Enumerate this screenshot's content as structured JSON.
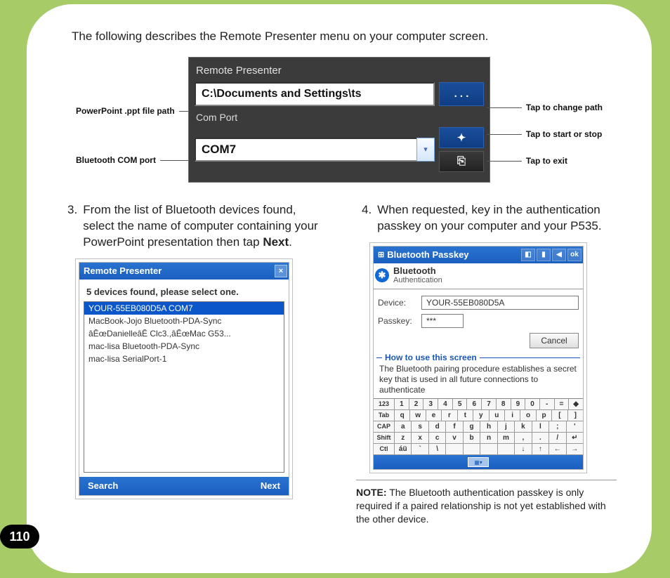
{
  "intro": "The following describes the Remote Presenter menu on your computer screen.",
  "figure": {
    "left_labels": {
      "ppt_path": "PowerPoint .ppt file path",
      "com_port": "Bluetooth COM port"
    },
    "right_labels": {
      "change_path": "Tap to change path",
      "start_stop": "Tap to start or stop",
      "exit": "Tap to exit"
    },
    "widget": {
      "title": "Remote Presenter",
      "path_value": "C:\\Documents and Settings\\ts",
      "browse_label": ". . .",
      "com_label": "Com Port",
      "com_value": "COM7",
      "start_icon": "✦",
      "exit_icon": "⎘"
    }
  },
  "steps": {
    "s3_num": "3.",
    "s3_text_a": "From the list of Bluetooth devices found, select the name of computer containing your PowerPoint presentation then tap ",
    "s3_text_b": "Next",
    "s3_text_c": ".",
    "s4_num": "4.",
    "s4_text": "When requested, key in the authentication passkey on your computer and your P535."
  },
  "device1": {
    "title": "Remote Presenter",
    "hint": "5 devices found, please select one.",
    "items": [
      "YOUR-55EB080D5A COM7",
      "MacBook-Jojo Bluetooth-PDA-Sync",
      "âĒœDanielleâĒ Clc3.,âĒœMac G53...",
      "mac-lisa Bluetooth-PDA-Sync",
      "mac-lisa SerialPort-1"
    ],
    "footer_left": "Search",
    "footer_right": "Next"
  },
  "device2": {
    "title": "Bluetooth Passkey",
    "tb_ok": "ok",
    "head_t1": "Bluetooth",
    "head_t2": "Authentication",
    "device_label": "Device:",
    "device_value": "YOUR-55EB080D5A",
    "passkey_label": "Passkey:",
    "passkey_value": "***",
    "cancel": "Cancel",
    "howto_title": "How to use this screen",
    "howto_text": "The Bluetooth pairing procedure establishes a secret key that is used in all future connections to authenticate",
    "keyboard": {
      "r1": [
        "123",
        "1",
        "2",
        "3",
        "4",
        "5",
        "6",
        "7",
        "8",
        "9",
        "0",
        "-",
        "=",
        "◆"
      ],
      "r2": [
        "Tab",
        "q",
        "w",
        "e",
        "r",
        "t",
        "y",
        "u",
        "i",
        "o",
        "p",
        "[",
        "]"
      ],
      "r3": [
        "CAP",
        "a",
        "s",
        "d",
        "f",
        "g",
        "h",
        "j",
        "k",
        "l",
        ";",
        "'"
      ],
      "r4": [
        "Shift",
        "z",
        "x",
        "c",
        "v",
        "b",
        "n",
        "m",
        ",",
        ".",
        "/",
        "↵"
      ],
      "r5": [
        "Ctl",
        "áü",
        "`",
        "\\",
        " ",
        " ",
        " ",
        " ",
        "↓",
        "↑",
        "←",
        "→"
      ]
    }
  },
  "note": {
    "label": "NOTE:",
    "text": " The Bluetooth authentication passkey is only required if a paired relationship is not yet established with the other device."
  },
  "page_number": "110"
}
